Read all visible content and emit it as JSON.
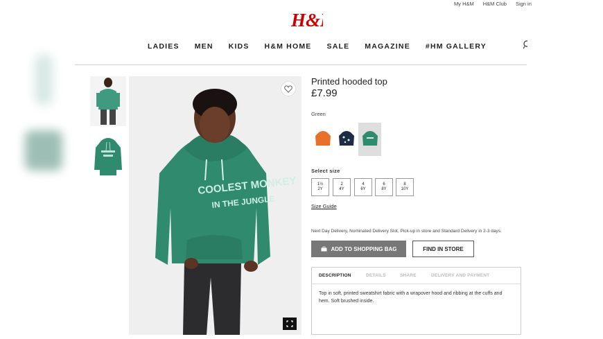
{
  "utility_links": [
    "My H&M",
    "H&M Club",
    "Sign in"
  ],
  "logo_text": "H&M",
  "nav": [
    "LADIES",
    "MEN",
    "KIDS",
    "H&M HOME",
    "SALE",
    "MAGAZINE",
    "#HM GALLERY"
  ],
  "product": {
    "title": "Printed hooded top",
    "price": "£7.99",
    "color_label": "Green",
    "hoodie_print_line1": "COOLEST MONKEY",
    "hoodie_print_line2": "IN THE JUNGLE",
    "swatches": [
      {
        "name": "orange",
        "color": "#e8702a"
      },
      {
        "name": "navy",
        "color": "#1f2a44"
      },
      {
        "name": "green",
        "color": "#2f8a6e"
      }
    ],
    "select_size_label": "Select size",
    "sizes": [
      {
        "line1": "1½",
        "line2": "2Y"
      },
      {
        "line1": "2",
        "line2": "4Y"
      },
      {
        "line1": "4",
        "line2": "6Y"
      },
      {
        "line1": "6",
        "line2": "8Y"
      },
      {
        "line1": "8",
        "line2": "10Y"
      }
    ],
    "size_guide": "Size Guide",
    "delivery_text": "Next Day Delivery, Nominated Delivery Slot, Pick-up in store and Standard Delivery in 2-3 days.",
    "add_to_bag": "ADD TO SHOPPING BAG",
    "find_in_store": "FIND IN STORE",
    "tabs": [
      "DESCRIPTION",
      "DETAILS",
      "SHARE",
      "DELIVERY AND PAYMENT"
    ],
    "active_tab": "DESCRIPTION",
    "description": "Top in soft, printed sweatshirt fabric with a wrapover hood and ribbing at the cuffs and hem. Soft brushed inside."
  },
  "colors": {
    "brand_red": "#cc0000",
    "hoodie_green": "#2f8a6e",
    "button_grey": "#777777"
  },
  "icons": [
    "heart-icon",
    "fullscreen-icon",
    "shopping-bag-icon",
    "search-icon"
  ]
}
